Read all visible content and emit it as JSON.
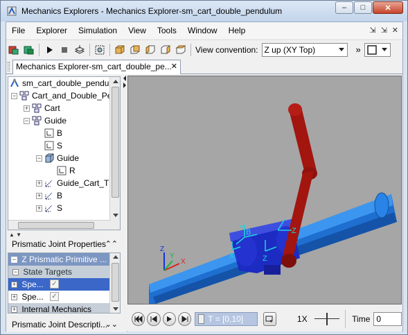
{
  "window": {
    "title": "Mechanics Explorers - Mechanics Explorer-sm_cart_double_pendulum"
  },
  "menu": {
    "items": [
      "File",
      "Explorer",
      "Simulation",
      "View",
      "Tools",
      "Window",
      "Help"
    ]
  },
  "toolbar": {
    "view_convention_label": "View convention:",
    "view_convention_value": "Z up (XY Top)",
    "overflow_label": "»"
  },
  "tab": {
    "label": "Mechanics Explorer-sm_cart_double_pe..."
  },
  "tree": {
    "root": "sm_cart_double_pendul",
    "items": [
      "Cart_and_Double_Pe",
      "Cart",
      "Guide",
      "B",
      "S",
      "Guide",
      "R",
      "Guide_Cart_T",
      "B",
      "S"
    ]
  },
  "properties": {
    "header": "Prismatic Joint Properties",
    "section": "Z Prismatic Primitive ...",
    "subsection": "State Targets",
    "rows": [
      "Spe...",
      "Spe..."
    ],
    "internal": "Internal Mechanics"
  },
  "description": {
    "header": "Prismatic Joint Descripti..."
  },
  "viewport": {
    "axis_labels": {
      "x": "X",
      "y": "Y",
      "z": "Z"
    }
  },
  "playback": {
    "time_range": "T = [0,10]",
    "speed": "1X",
    "time_label": "Time",
    "time_value": "0"
  },
  "colors": {
    "rail": "#1f78d8",
    "cart": "#1c2bc2",
    "pendulum": "#a3150f",
    "frame": "#20d2e0",
    "viewport_bg": "#a6a6a6"
  }
}
